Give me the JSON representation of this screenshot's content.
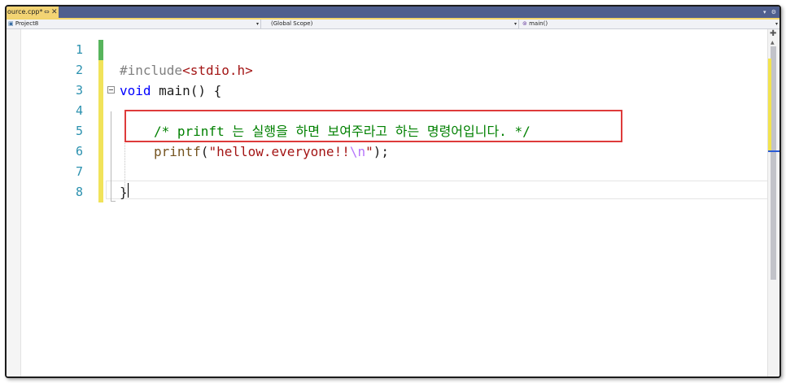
{
  "tab": {
    "title": "ource.cpp*",
    "pin_icon": "pin-icon",
    "close_icon": "close-icon"
  },
  "tabbar_right": {
    "dropdown_icon": "chevron-down-icon",
    "settings_icon": "gear-icon"
  },
  "navbar": {
    "project": "Project8",
    "scope": "(Global Scope)",
    "function": "main()"
  },
  "code": {
    "line_numbers": [
      "1",
      "2",
      "3",
      "4",
      "5",
      "6",
      "7",
      "8"
    ],
    "line2": {
      "directive": "#include",
      "header": "<stdio.h>"
    },
    "line3": {
      "keyword": "void",
      "rest": " main() {"
    },
    "line5": {
      "comment": "/* prinft 는 실행을 하면 보여주라고 하는 명령어입니다. */"
    },
    "line6": {
      "func": "printf",
      "open": "(",
      "str_a": "\"hellow.everyone!!",
      "esc": "\\n",
      "str_b": "\"",
      "close": ");"
    },
    "line8": {
      "brace": "}"
    }
  },
  "colors": {
    "tab_active": "#f3d474",
    "tabbar": "#4f5f8e",
    "line_number": "#2b91af",
    "keyword": "#0000ff",
    "string": "#a31515",
    "comment": "#008000",
    "preprocessor": "#808080",
    "function": "#74531f",
    "escape": "#b776fb",
    "highlight_box": "#de3b3b"
  }
}
